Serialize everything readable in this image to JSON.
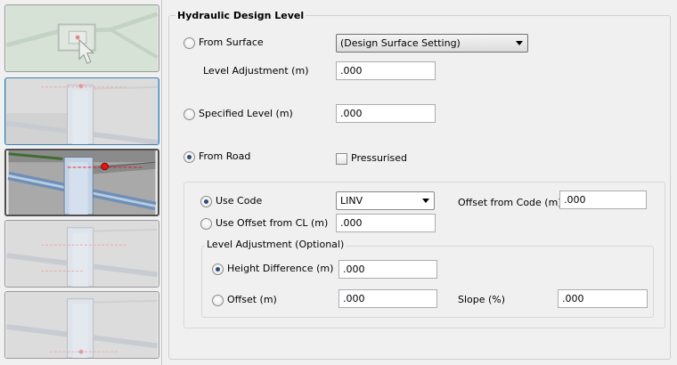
{
  "section_title": "Hydraulic Design Level",
  "thumbnails": [
    {
      "name": "plan-view",
      "state": "normal"
    },
    {
      "name": "section-view-1",
      "state": "selected"
    },
    {
      "name": "section-view-from-road",
      "state": "active"
    },
    {
      "name": "section-view-3",
      "state": "normal"
    },
    {
      "name": "section-view-4",
      "state": "normal"
    }
  ],
  "from_surface": {
    "label": "From Surface",
    "selected": false,
    "dropdown_value": "(Design Surface Setting)",
    "level_adjustment_label": "Level Adjustment (m)",
    "level_adjustment_value": ".000"
  },
  "specified_level": {
    "label": "Specified Level (m)",
    "selected": false,
    "value": ".000"
  },
  "from_road": {
    "label": "From Road",
    "selected": true,
    "pressurised_label": "Pressurised",
    "pressurised_checked": false,
    "use_code": {
      "label": "Use Code",
      "selected": true,
      "code_value": "LINV",
      "offset_label": "Offset from Code (m)",
      "offset_value": ".000"
    },
    "use_offset_from_cl": {
      "label": "Use Offset from CL (m)",
      "selected": false,
      "value": ".000"
    },
    "level_adjustment": {
      "group_label": "Level Adjustment (Optional)",
      "height_difference_label": "Height Difference (m)",
      "height_difference_selected": true,
      "height_difference_value": ".000",
      "offset_label": "Offset (m)",
      "offset_selected": false,
      "offset_value": ".000",
      "slope_label": "Slope (%)",
      "slope_value": ".000"
    }
  },
  "colors": {
    "accent_red": "#e01818",
    "selection_blue": "#8fc0e8",
    "pipe_blue": "#7fa2c8"
  }
}
